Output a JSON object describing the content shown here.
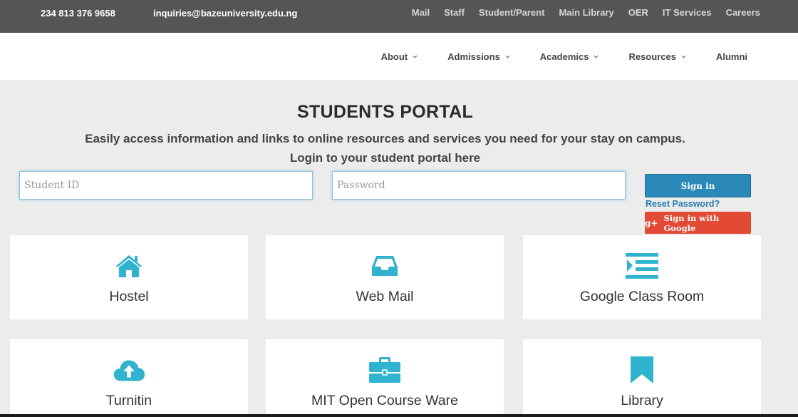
{
  "topbar": {
    "phone": "234 813 376 9658",
    "email": "inquiries@bazeuniversity.edu.ng",
    "links": [
      "Mail",
      "Staff",
      "Student/Parent",
      "Main Library",
      "OER",
      "IT Services",
      "Careers"
    ]
  },
  "nav": {
    "items": [
      {
        "label": "About",
        "dropdown": true
      },
      {
        "label": "Admissions",
        "dropdown": true
      },
      {
        "label": "Academics",
        "dropdown": true
      },
      {
        "label": "Resources",
        "dropdown": true
      },
      {
        "label": "Alumni",
        "dropdown": false
      }
    ]
  },
  "portal": {
    "title": "STUDENTS PORTAL",
    "subtitle": "Easily access information and links to online resources and services you need for your stay on campus.",
    "subtitle2": "Login to your student portal here",
    "student_id_placeholder": "Student ID",
    "password_placeholder": "Password",
    "signin_label": "Sign in",
    "reset_label": "Reset Password?",
    "google_label": "Sign in with Google",
    "google_glyph": "g+"
  },
  "cards": [
    {
      "label": "Hostel",
      "icon": "home-icon"
    },
    {
      "label": "Web Mail",
      "icon": "inbox-icon"
    },
    {
      "label": "Google Class Room",
      "icon": "list-indent-icon"
    },
    {
      "label": "Turnitin",
      "icon": "cloud-upload-icon"
    },
    {
      "label": "MIT Open Course Ware",
      "icon": "briefcase-icon"
    },
    {
      "label": "Library",
      "icon": "bookmark-icon"
    }
  ],
  "colors": {
    "accent": "#2fb3cf",
    "topbar": "#555555",
    "signin": "#2a89b8",
    "google": "#e24a35",
    "link": "#2a7db0"
  }
}
